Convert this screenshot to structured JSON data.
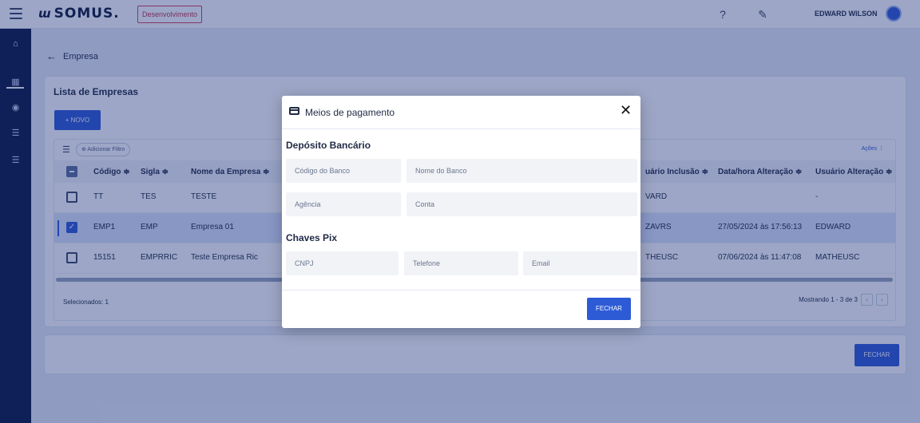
{
  "topbar": {
    "logo_mark": "ɯ",
    "logo_text": "SOMUS.",
    "env_badge": "Desenvolvimento",
    "help_icon": "?",
    "notes_icon": "✎",
    "user_name": "EDWARD WILSON"
  },
  "sidebar": {
    "items": [
      {
        "icon": "home-icon",
        "glyph": "⌂"
      },
      {
        "icon": "grid-icon",
        "glyph": "▦"
      },
      {
        "icon": "location-icon",
        "glyph": "◉"
      },
      {
        "icon": "list-icon",
        "glyph": "☰"
      },
      {
        "icon": "list-icon",
        "glyph": "☰"
      }
    ]
  },
  "breadcrumb": {
    "back_glyph": "←",
    "label": "Empresa"
  },
  "list": {
    "title": "Lista de Empresas",
    "new_button": "+ NOVO",
    "filter_chip": "⊕ Adicionar Filtro",
    "actions_label": "Ações ⋮",
    "columns": [
      "Código",
      "Sigla",
      "Nome da Empresa",
      "Usuário Inclusão",
      "Data/hora Alteração",
      "Usuário Alteração"
    ],
    "columns_visible": [
      "Código ≑",
      "Sigla ≑",
      "Nome da Empresa ≑",
      "uário Inclusão ≑",
      "Data/hora Alteração ≑",
      "Usuário Alteração ≑"
    ],
    "rows": [
      {
        "codigo": "TT",
        "sigla": "TES",
        "nome": "TESTE",
        "usuario_inclusao": "VARD",
        "data_alteracao": "",
        "usuario_alteracao": "-",
        "selected": false
      },
      {
        "codigo": "EMP1",
        "sigla": "EMP",
        "nome": "Empresa 01",
        "usuario_inclusao": "ZAVRS",
        "data_alteracao": "27/05/2024 às 17:56:13",
        "usuario_alteracao": "EDWARD",
        "selected": true
      },
      {
        "codigo": "15151",
        "sigla": "EMPRRIC",
        "nome": "Teste Empresa Ric",
        "usuario_inclusao": "THEUSC",
        "data_alteracao": "07/06/2024 às 11:47:08",
        "usuario_alteracao": "MATHEUSC",
        "selected": false
      }
    ],
    "selected_label": "Selecionados: 1",
    "pagination_label": "Mostrando 1 - 3 de 3",
    "prev_glyph": "‹",
    "next_glyph": "›"
  },
  "page_footer": {
    "close_button": "FECHAR"
  },
  "modal": {
    "title": "Meios de pagamento",
    "close_glyph": "✕",
    "section_bank": "Depósito Bancário",
    "field_bank_code": "Código do Banco",
    "field_bank_name": "Nome do Banco",
    "field_agency": "Agência",
    "field_account": "Conta",
    "section_pix": "Chaves Pix",
    "field_cnpj": "CNPJ",
    "field_phone": "Telefone",
    "field_email": "Email",
    "close_button": "FECHAR"
  },
  "colors": {
    "primary": "#2d5bd6",
    "sidebar": "#0b1742",
    "overlay": "#152c78",
    "env_badge": "#c0344d"
  }
}
